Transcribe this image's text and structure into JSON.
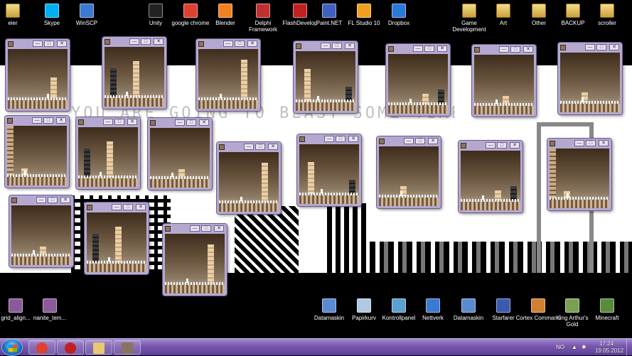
{
  "desktop": {
    "top_icons": [
      {
        "label": "eier",
        "icon": "folder-user-icon",
        "color": "#e8c870"
      },
      {
        "label": "Skype",
        "icon": "skype-icon",
        "color": "#00aff0"
      },
      {
        "label": "WinSCP",
        "icon": "winscp-icon",
        "color": "#3a7ad0"
      },
      {
        "label": "Unity",
        "icon": "unity-icon",
        "color": "#222222"
      },
      {
        "label": "google chrome",
        "icon": "chrome-icon",
        "color": "#e04030"
      },
      {
        "label": "Blender",
        "icon": "blender-icon",
        "color": "#f08020"
      },
      {
        "label": "Delphi Framework",
        "icon": "delphi-icon",
        "color": "#c03030"
      },
      {
        "label": "FlashDevelop",
        "icon": "flashdevelop-icon",
        "color": "#c02020"
      },
      {
        "label": "Paint.NET",
        "icon": "paintnet-icon",
        "color": "#4060c0"
      },
      {
        "label": "FL Studio 10",
        "icon": "flstudio-icon",
        "color": "#f0a020"
      },
      {
        "label": "Dropbox",
        "icon": "dropbox-icon",
        "color": "#2a7ad8"
      },
      {
        "label": "Game Development",
        "icon": "folder-icon",
        "color": "#e8c870"
      },
      {
        "label": "Art",
        "icon": "folder-icon",
        "color": "#e8c870"
      },
      {
        "label": "Other",
        "icon": "folder-icon",
        "color": "#e8c870"
      },
      {
        "label": "BACKUP",
        "icon": "folder-icon",
        "color": "#e8c870"
      },
      {
        "label": "scroller",
        "icon": "folder-icon",
        "color": "#e8c870"
      }
    ],
    "bottom_left_icons": [
      {
        "label": "grid_align...",
        "icon": "image-file-icon"
      },
      {
        "label": "nanite_tem...",
        "icon": "image-file-icon"
      }
    ],
    "bottom_right_icons": [
      {
        "label": "Datamaskin",
        "icon": "computer-icon"
      },
      {
        "label": "Papirkurv",
        "icon": "recycle-bin-icon"
      },
      {
        "label": "Kontrollpanel",
        "icon": "control-panel-icon"
      },
      {
        "label": "Nettverk",
        "icon": "network-icon"
      },
      {
        "label": "Datamaskin",
        "icon": "computer-icon"
      },
      {
        "label": "Starfarer",
        "icon": "starfarer-icon"
      },
      {
        "label": "Cortex Command",
        "icon": "cortex-command-icon"
      },
      {
        "label": "King Arthur's Gold",
        "icon": "kag-icon"
      },
      {
        "label": "Minecraft",
        "icon": "minecraft-icon"
      }
    ],
    "wallpaper_text": "YOU ARE GOING TO BEAST SOME TIME"
  },
  "game_window": {
    "minimize_glyph": "—",
    "maximize_glyph": "□",
    "close_glyph": "✕"
  },
  "taskbar": {
    "items": [
      {
        "icon": "chrome-taskbar-icon",
        "color": "#e04030"
      },
      {
        "icon": "flashdevelop-taskbar-icon",
        "color": "#c02020"
      },
      {
        "icon": "explorer-taskbar-icon",
        "color": "#e8c870"
      },
      {
        "icon": "game-taskbar-icon",
        "color": "#8a7460"
      }
    ],
    "language": "NO",
    "time": "17:24",
    "date": "19.05.2012"
  }
}
